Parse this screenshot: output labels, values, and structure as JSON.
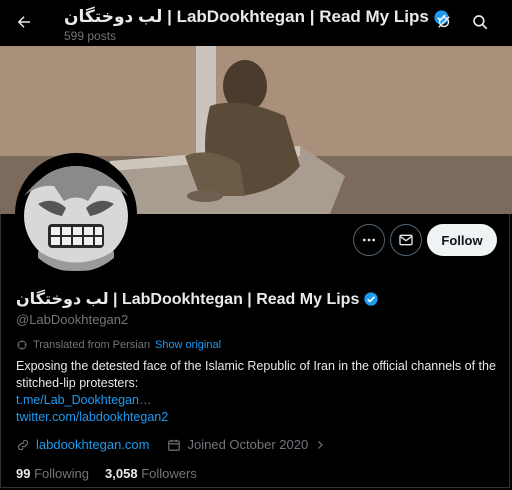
{
  "header": {
    "title": "لب دوختگان | LabDookhtegan | Read My Lips",
    "posts_count": "599 posts"
  },
  "profile": {
    "display_name": "لب دوختگان | LabDookhtegan | Read My Lips",
    "handle": "@LabDookhtegan2",
    "follow_label": "Follow",
    "translated_label": "Translated from Persian",
    "show_original": "Show original",
    "bio": "Exposing the detested face of the Islamic Republic of Iran in the official channels of the stitched-lip protesters:",
    "link1": "t.me/Lab_Dookhtegan…",
    "link2": "twitter.com/labdookhtegan2",
    "website": "labdookhtegan.com",
    "joined": "Joined October 2020",
    "following_count": "99",
    "following_label": "Following",
    "followers_count": "3,058",
    "followers_label": "Followers"
  },
  "icons": {
    "back": "arrow-left-icon",
    "verified": "verified-badge-icon",
    "notify": "bell-off-icon",
    "search": "search-icon",
    "more": "more-icon",
    "message": "envelope-icon",
    "translate": "translate-icon",
    "link": "link-icon",
    "calendar": "calendar-icon"
  },
  "colors": {
    "accent": "#1d9bf0",
    "muted": "#71767b",
    "text": "#e7e9ea",
    "background": "#000000"
  }
}
